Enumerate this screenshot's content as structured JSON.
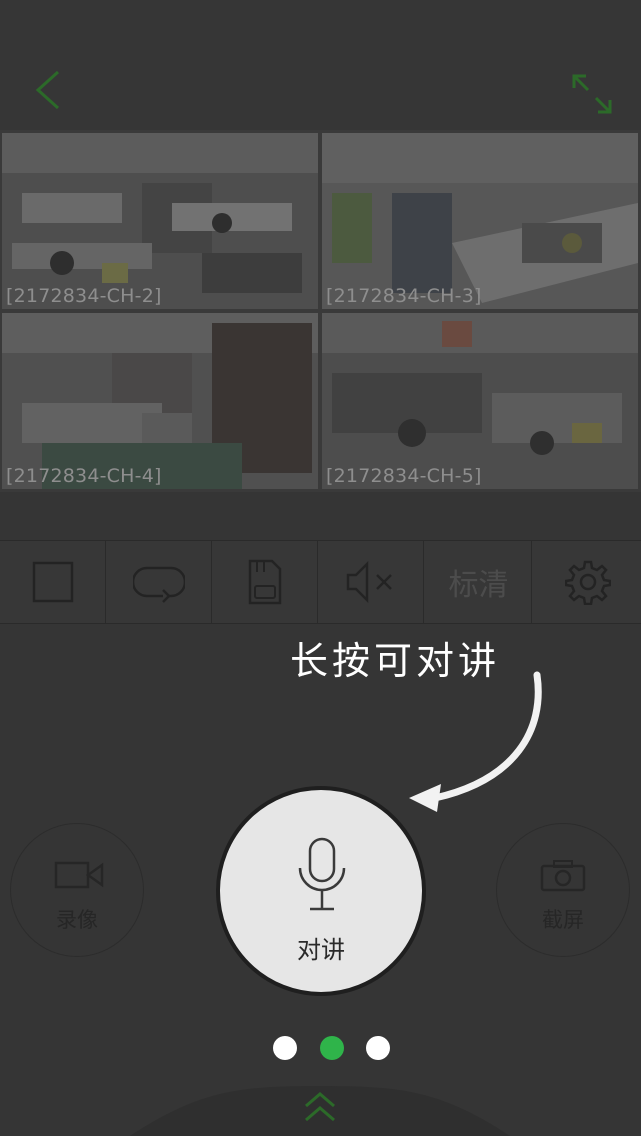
{
  "header": {
    "back_icon": "chevron-left-icon",
    "fullscreen_icon": "expand-diagonal-icon",
    "accent_color": "#2e7d2a"
  },
  "cameras": [
    {
      "label": "[2172834-CH-2]",
      "selected": true
    },
    {
      "label": "[2172834-CH-3]",
      "selected": false
    },
    {
      "label": "[2172834-CH-4]",
      "selected": false
    },
    {
      "label": "[2172834-CH-5]",
      "selected": false
    }
  ],
  "toolbar": {
    "items": [
      {
        "icon": "single-view-square-icon"
      },
      {
        "icon": "loop-playback-icon"
      },
      {
        "icon": "sd-card-icon"
      },
      {
        "icon": "speaker-muted-icon"
      },
      {
        "label": "标清"
      },
      {
        "icon": "gear-icon"
      }
    ]
  },
  "hint": {
    "text": "长按可对讲",
    "icon": "curved-arrow-icon"
  },
  "actions": {
    "record": {
      "label": "录像",
      "icon": "video-camera-icon"
    },
    "talk": {
      "label": "对讲",
      "icon": "microphone-icon"
    },
    "screenshot": {
      "label": "截屏",
      "icon": "camera-icon"
    }
  },
  "pager": {
    "total": 3,
    "active_index": 1,
    "active_color": "#2fb44a"
  },
  "bottom": {
    "icon": "double-chevron-up-icon",
    "color": "#2e7d2a"
  }
}
